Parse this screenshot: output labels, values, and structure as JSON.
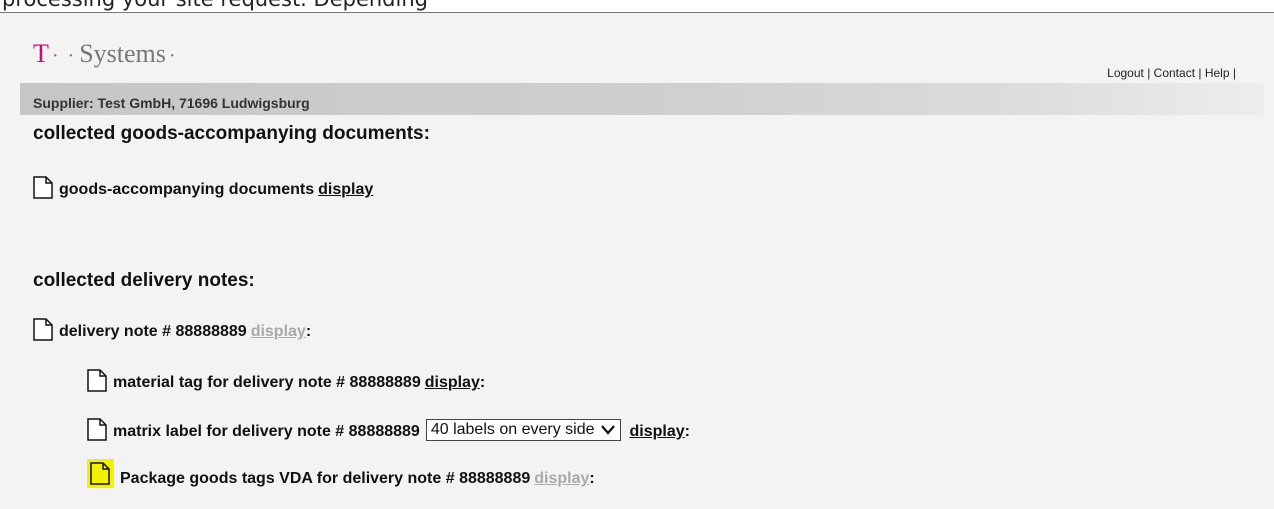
{
  "browser_crop": {
    "partial_text": "processing your site request. Depending"
  },
  "header": {
    "logo": {
      "t": "T",
      "dots": "· ·",
      "word": "Systems",
      "end_dot": "·"
    },
    "links": {
      "logout": "Logout",
      "contact": "Contact",
      "help": "Help",
      "sep": "|"
    }
  },
  "supplier": {
    "text": "Supplier: Test GmbH, 71696 Ludwigsburg"
  },
  "sections": {
    "goods_docs": {
      "heading": "collected goods-accompanying documents:",
      "row": {
        "label": "goods-accompanying documents",
        "link": "display"
      }
    },
    "delivery_notes": {
      "heading": "collected delivery notes:",
      "rows": [
        {
          "label": "delivery note # 88888889",
          "link": "display",
          "suffix": ":",
          "icon": "document-icon"
        },
        {
          "label": "material tag for delivery note # 88888889",
          "link": "display",
          "suffix": ":",
          "icon": "document-icon"
        },
        {
          "label": "matrix label for delivery note # 88888889",
          "select_value": "40 labels on every side",
          "link": "display",
          "suffix": ":",
          "icon": "document-icon"
        },
        {
          "label": "Package goods tags VDA for delivery note # 88888889",
          "link": "display",
          "suffix": ":",
          "icon": "document-highlighted-icon"
        }
      ]
    }
  },
  "colors": {
    "brand_magenta": "#e20074",
    "logo_gray": "#777777",
    "highlight_yellow": "#f2f200",
    "disabled_link": "#aaaaaa"
  }
}
